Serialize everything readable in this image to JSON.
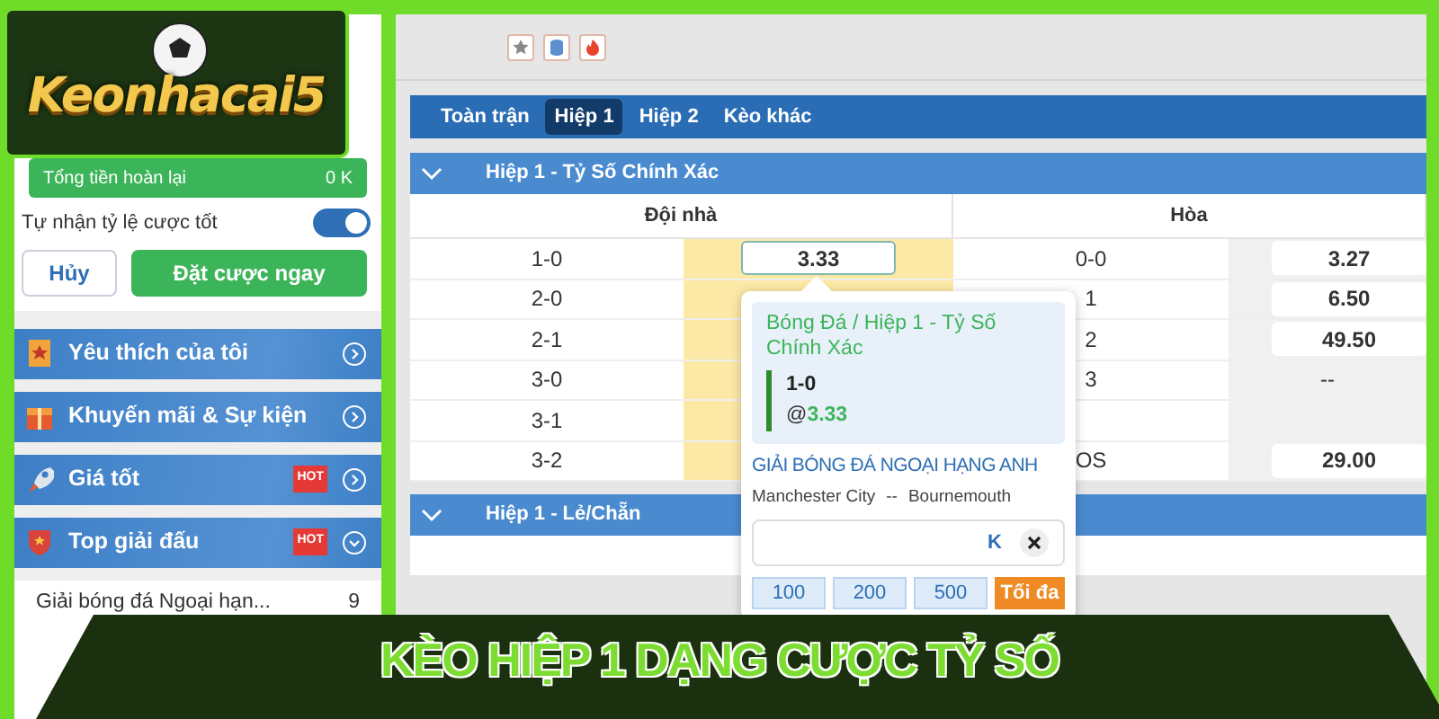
{
  "logo": {
    "text": "Keonhacai5"
  },
  "sidebar": {
    "refund": {
      "label": "Tổng tiền hoàn lại",
      "value": "0 K"
    },
    "auto_odds": {
      "label": "Tự nhận tỷ lệ cược tốt",
      "on": true
    },
    "buttons": {
      "cancel": "Hủy",
      "confirm": "Đặt cược ngay"
    },
    "menu": [
      {
        "label": "Yêu thích của tôi",
        "kind": "favorite",
        "expanded": false
      },
      {
        "label": "Khuyến mãi & Sự kiện",
        "kind": "promo",
        "expanded": false
      },
      {
        "label": "Giá tốt",
        "kind": "rocket",
        "badge": "HOT",
        "expanded": false
      },
      {
        "label": "Top giải đấu",
        "kind": "trophy",
        "badge": "HOT",
        "expanded": true
      }
    ],
    "leagues": [
      {
        "name": "Giải bóng đá Ngoại hạn...",
        "count": "9"
      }
    ]
  },
  "tabs": [
    {
      "label": "Toàn trận",
      "selected": false
    },
    {
      "label": "Hiệp 1",
      "selected": true
    },
    {
      "label": "Hiệp 2",
      "selected": false
    },
    {
      "label": "Kèo khác",
      "selected": false
    }
  ],
  "sections": [
    {
      "title": "Hiệp 1 - Tỷ Số Chính Xác",
      "expanded": true,
      "columns": [
        {
          "label": "Đội nhà",
          "highlighted": true
        },
        {
          "label": "Hòa",
          "highlighted": false
        }
      ],
      "rows": [
        {
          "home_score": "1-0",
          "home_odds": "3.33",
          "home_selected": true,
          "draw_score": "0-0",
          "draw_odds": "3.27",
          "draw_boxed": true
        },
        {
          "home_score": "2-0",
          "draw_score": "1",
          "draw_odds": "6.50",
          "draw_boxed": true
        },
        {
          "home_score": "2-1",
          "draw_score": "2",
          "draw_odds": "49.50",
          "draw_boxed": true
        },
        {
          "home_score": "3-0",
          "draw_score": "3",
          "draw_odds": "--",
          "draw_boxed": false
        },
        {
          "home_score": "3-1"
        },
        {
          "home_score": "3-2",
          "draw_score": "OS",
          "draw_odds": "29.00",
          "draw_boxed": true
        }
      ]
    },
    {
      "title": "Hiệp 1 - Lẻ/Chẵn",
      "expanded": true
    }
  ],
  "bet_slip": {
    "market": "Bóng Đá / Hiệp 1 - Tỷ Số Chính Xác",
    "pick": "1-0",
    "odds_prefix": "@",
    "odds": "3.33",
    "league": "GIẢI BÓNG ĐÁ NGOẠI HẠNG ANH",
    "home_team": "Manchester City",
    "separator": "--",
    "away_team": "Bournemouth",
    "stake_unit": "K",
    "quick_stakes": [
      "100",
      "200",
      "500"
    ],
    "max_label": "Tối đa"
  },
  "banner": {
    "title": "KÈO HIỆP 1 DẠNG CƯỢC TỶ SỐ"
  }
}
